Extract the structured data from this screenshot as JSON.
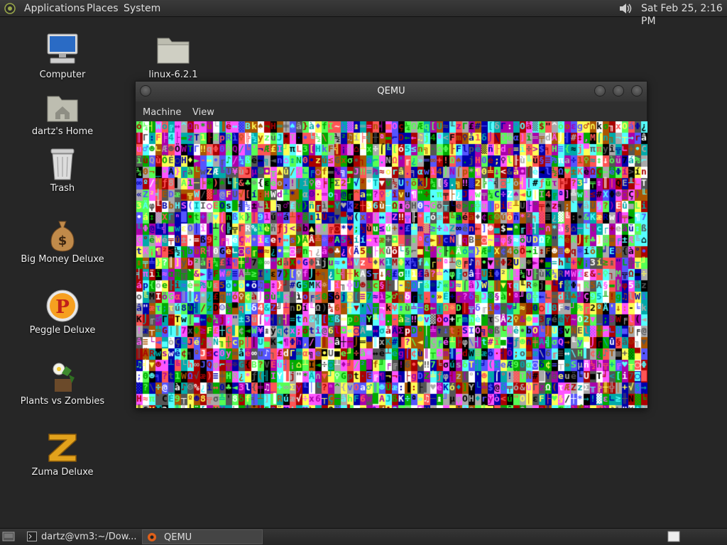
{
  "top_panel": {
    "menus": [
      "Applications",
      "Places",
      "System"
    ],
    "clock": "Sat Feb 25,  2:16 PM",
    "volume_icon": "speaker-icon"
  },
  "desktop": {
    "icons": [
      {
        "label": "Computer",
        "icon": "computer-icon"
      },
      {
        "label": "dartz's Home",
        "icon": "home-folder-icon"
      },
      {
        "label": "Trash",
        "icon": "trash-icon"
      },
      {
        "label": "Big Money Deluxe",
        "icon": "money-bag-icon"
      },
      {
        "label": "Peggle Deluxe",
        "icon": "peggle-icon"
      },
      {
        "label": "Plants vs Zombies",
        "icon": "plants-vs-zombies-icon"
      },
      {
        "label": "Zuma Deluxe",
        "icon": "zuma-icon"
      },
      {
        "label": "linux-6.2.1",
        "icon": "folder-icon"
      }
    ]
  },
  "qemu": {
    "title": "QEMU",
    "menus": [
      "Machine",
      "View"
    ],
    "screen_content": "garbled-text-mode-display"
  },
  "taskbar": {
    "tasks": [
      {
        "label": "dartz@vm3:~/Dow...",
        "icon": "terminal-icon",
        "active": false
      },
      {
        "label": "QEMU",
        "icon": "qemu-icon",
        "active": true
      }
    ],
    "show_desktop_icon": "show-desktop-icon",
    "workspace_icon": "workspace-switcher-icon"
  },
  "colors": {
    "desktop_bg": "#262626",
    "panel_bg": "#333333"
  }
}
